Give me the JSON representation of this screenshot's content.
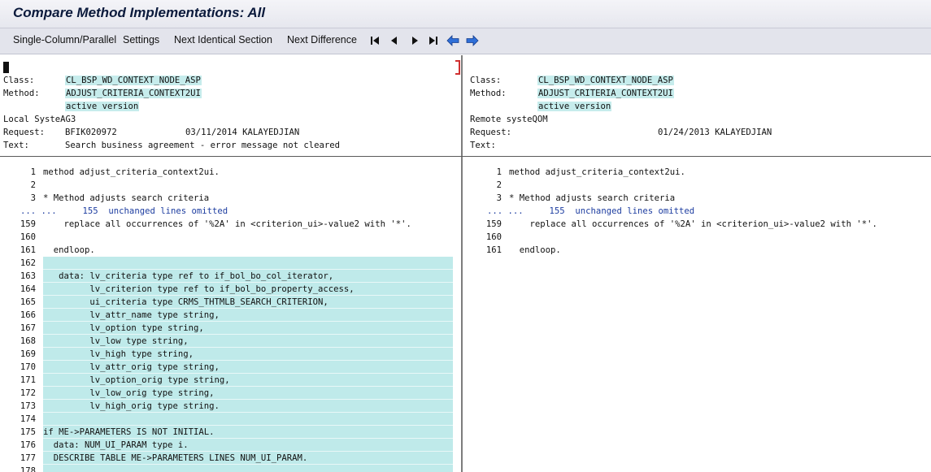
{
  "window": {
    "title": "Compare Method Implementations: All"
  },
  "toolbar": {
    "single_parallel": "Single-Column/Parallel",
    "settings": "Settings",
    "next_identical": "Next Identical Section",
    "next_difference": "Next Difference",
    "icons": [
      "first-page-icon",
      "prev-page-icon",
      "next-page-icon",
      "last-page-icon",
      "arrow-left-icon",
      "arrow-right-icon"
    ]
  },
  "left": {
    "class_label": "Class:",
    "class_value": "CL_BSP_WD_CONTEXT_NODE_ASP",
    "method_label": "Method:",
    "method_value": "ADJUST_CRITERIA_CONTEXT2UI",
    "version": "active version",
    "system": "Local SysteAG3",
    "request_label": "Request:",
    "request_value": "BFIK020972",
    "request_date_user": "03/11/2014 KALAYEDJIAN",
    "text_label": "Text:",
    "text_value": "Search business agreement - error message not cleared",
    "omit_prefix": "... ...",
    "omit_count": "155",
    "omit_text": "unchanged lines omitted",
    "lines": [
      {
        "n": "1",
        "t": "method adjust_criteria_context2ui.",
        "c": false
      },
      {
        "n": "2",
        "t": "",
        "c": false
      },
      {
        "n": "3",
        "t": "* Method adjusts search criteria",
        "c": false
      },
      {
        "n": "159",
        "t": "    replace all occurrences of '%2A' in <criterion_ui>-value2 with '*'.",
        "c": false
      },
      {
        "n": "160",
        "t": "",
        "c": false
      },
      {
        "n": "161",
        "t": "  endloop.",
        "c": false
      },
      {
        "n": "162",
        "t": "",
        "c": true
      },
      {
        "n": "163",
        "t": "   data: lv_criteria type ref to if_bol_bo_col_iterator,",
        "c": true
      },
      {
        "n": "164",
        "t": "         lv_criterion type ref to if_bol_bo_property_access,",
        "c": true
      },
      {
        "n": "165",
        "t": "         ui_criteria type CRMS_THTMLB_SEARCH_CRITERION,",
        "c": true
      },
      {
        "n": "166",
        "t": "         lv_attr_name type string,",
        "c": true
      },
      {
        "n": "167",
        "t": "         lv_option type string,",
        "c": true
      },
      {
        "n": "168",
        "t": "         lv_low type string,",
        "c": true
      },
      {
        "n": "169",
        "t": "         lv_high type string,",
        "c": true
      },
      {
        "n": "170",
        "t": "         lv_attr_orig type string,",
        "c": true
      },
      {
        "n": "171",
        "t": "         lv_option_orig type string,",
        "c": true
      },
      {
        "n": "172",
        "t": "         lv_low_orig type string,",
        "c": true
      },
      {
        "n": "173",
        "t": "         lv_high_orig type string.",
        "c": true
      },
      {
        "n": "174",
        "t": "",
        "c": true
      },
      {
        "n": "175",
        "t": "if ME->PARAMETERS IS NOT INITIAL.",
        "c": true
      },
      {
        "n": "176",
        "t": "  data: NUM_UI_PARAM type i.",
        "c": true
      },
      {
        "n": "177",
        "t": "  DESCRIBE TABLE ME->PARAMETERS LINES NUM_UI_PARAM.",
        "c": true
      },
      {
        "n": "178",
        "t": "",
        "c": true
      }
    ]
  },
  "right": {
    "class_label": "Class:",
    "class_value": "CL_BSP_WD_CONTEXT_NODE_ASP",
    "method_label": "Method:",
    "method_value": "ADJUST_CRITERIA_CONTEXT2UI",
    "version": "active version",
    "system": "Remote systeQOM",
    "request_label": "Request:",
    "request_date_user": "01/24/2013 KALAYEDJIAN",
    "text_label": "Text:",
    "omit_prefix": "... ...",
    "omit_count": "155",
    "omit_text": "unchanged lines omitted",
    "lines": [
      {
        "n": "1",
        "t": "method adjust_criteria_context2ui."
      },
      {
        "n": "2",
        "t": ""
      },
      {
        "n": "3",
        "t": "* Method adjusts search criteria"
      },
      {
        "n": "159",
        "t": "    replace all occurrences of '%2A' in <criterion_ui>-value2 with '*'."
      },
      {
        "n": "160",
        "t": ""
      },
      {
        "n": "161",
        "t": "  endloop."
      }
    ]
  }
}
